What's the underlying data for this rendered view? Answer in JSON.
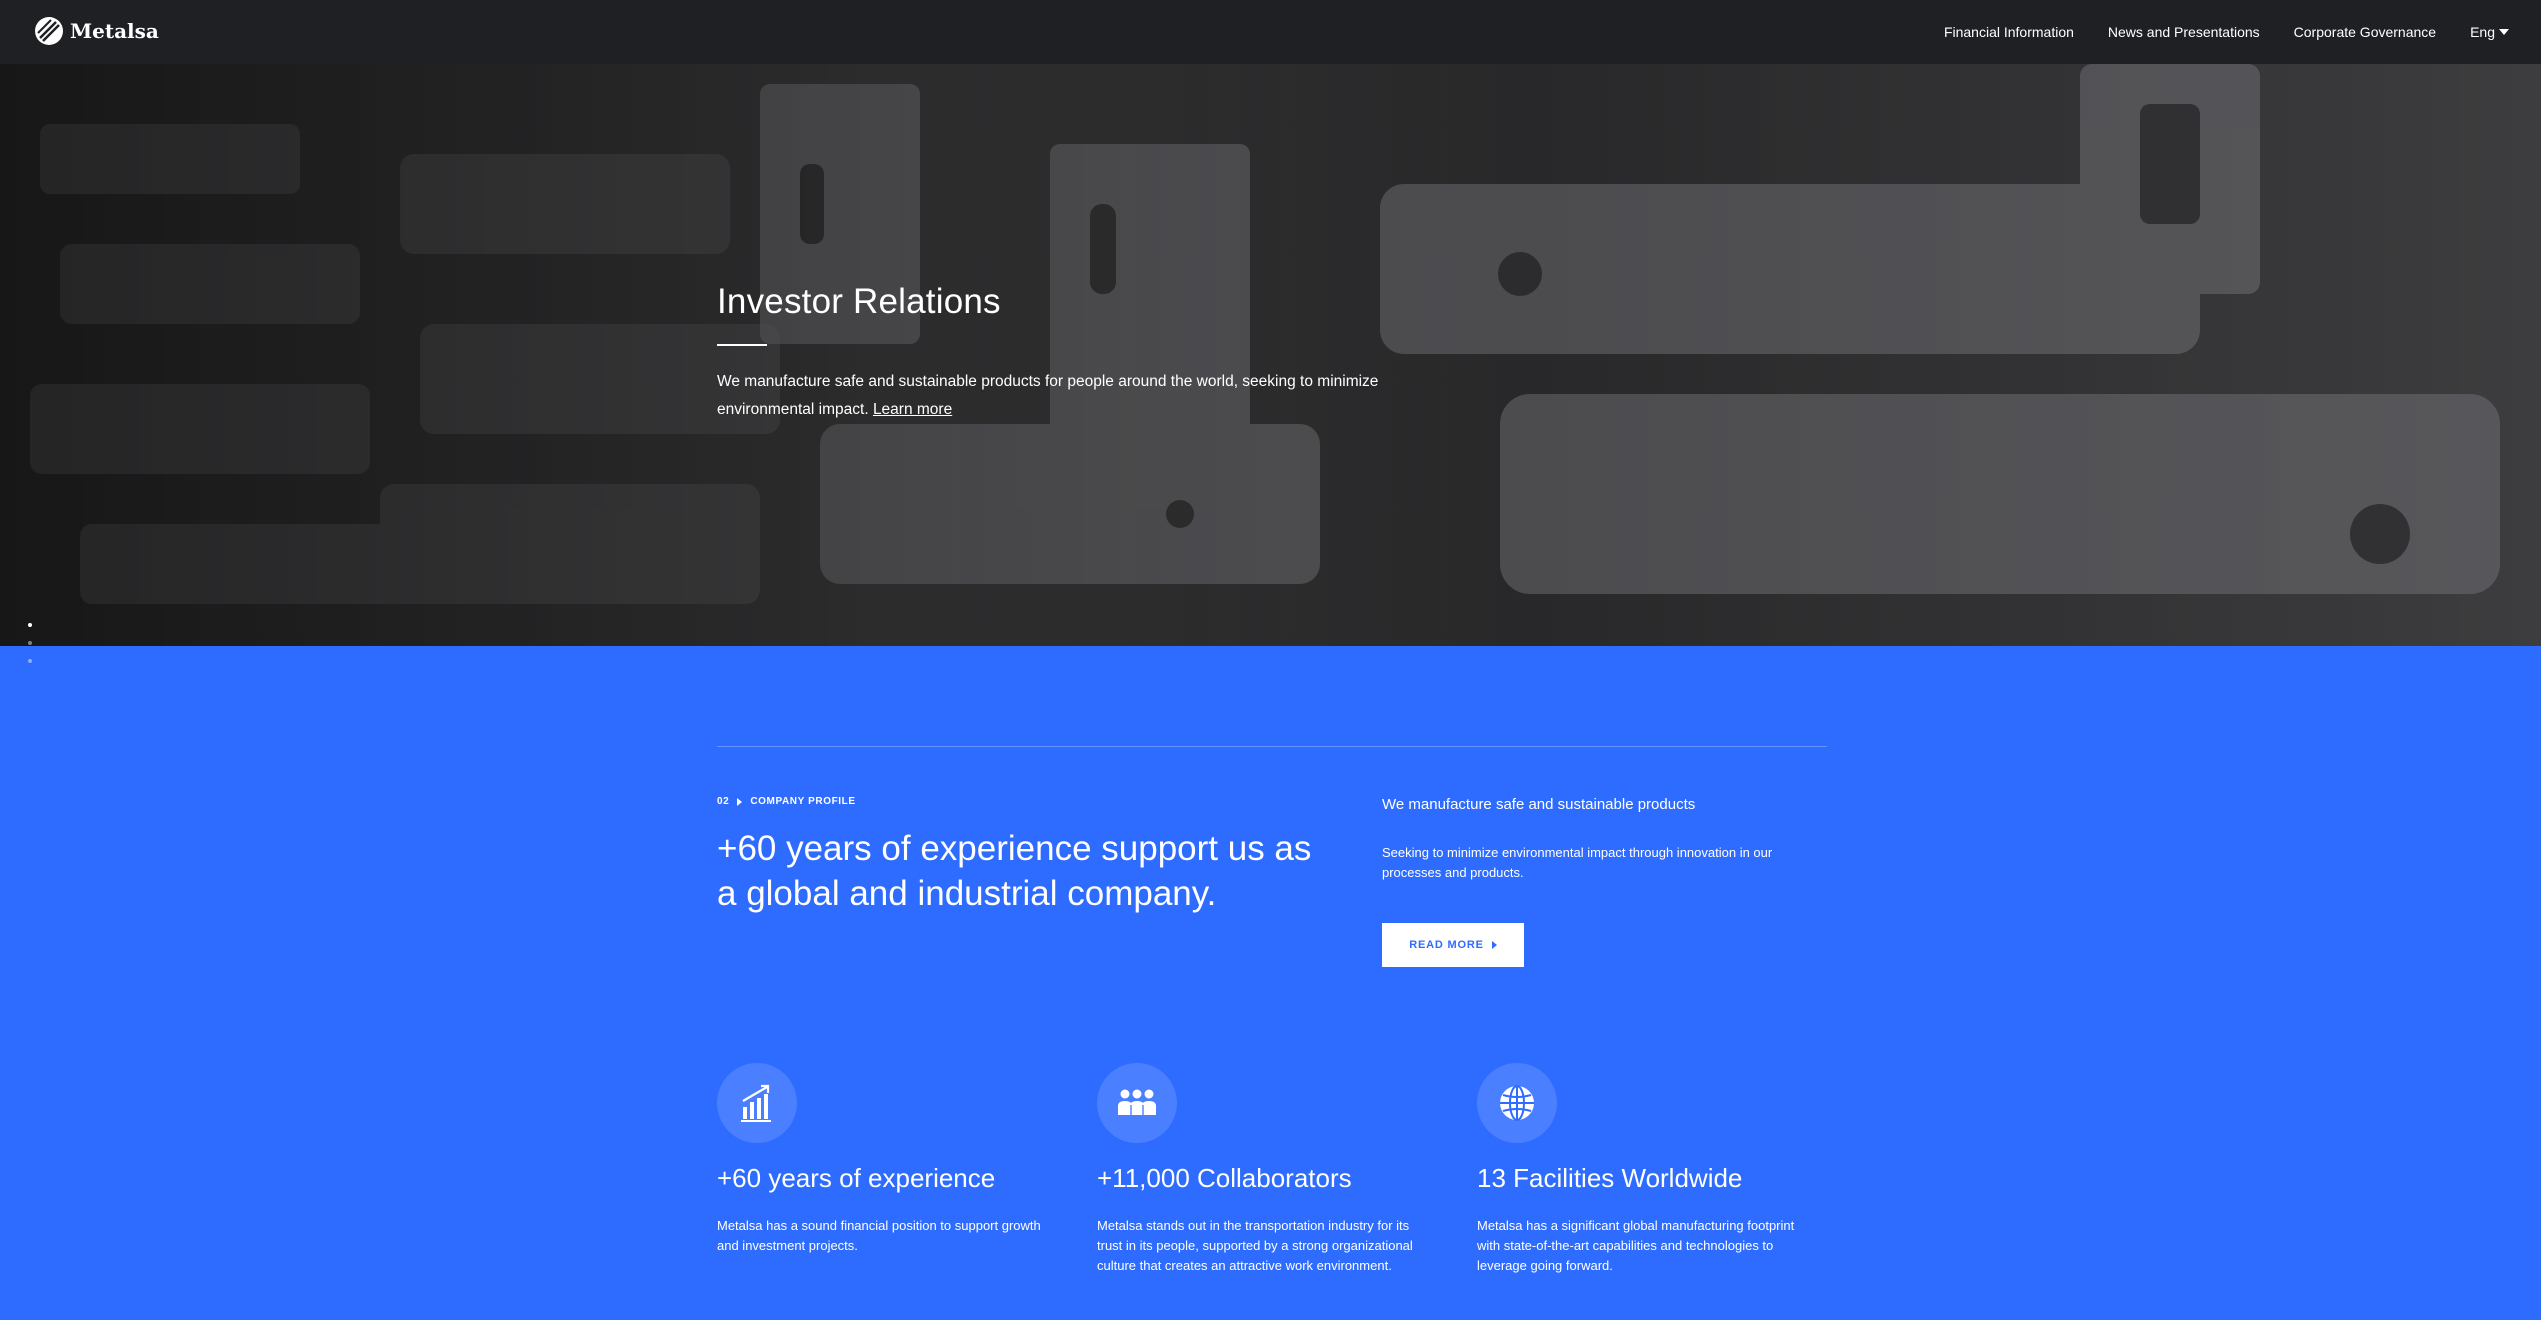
{
  "header": {
    "logo_text": "Metalsa",
    "nav": [
      {
        "label": "Financial Information"
      },
      {
        "label": "News and Presentations"
      },
      {
        "label": "Corporate Governance"
      }
    ],
    "language": "Eng"
  },
  "hero": {
    "title": "Investor Relations",
    "description": "We manufacture safe and sustainable products for people around the world, seeking to minimize environmental impact.",
    "link_label": "Learn more"
  },
  "profile": {
    "kicker_number": "02",
    "kicker_label": "COMPANY PROFILE",
    "heading": "+60 years of experience support us as a global and industrial company.",
    "right_title": "We manufacture safe and sustainable products",
    "right_desc": "Seeking to minimize environmental impact through innovation in our processes and products.",
    "button_label": "READ MORE"
  },
  "stats": [
    {
      "icon": "growth-chart-icon",
      "title": "+60 years of experience",
      "desc": "Metalsa has a sound financial position to support growth and investment projects."
    },
    {
      "icon": "people-group-icon",
      "title": "+11,000 Collaborators",
      "desc": "Metalsa stands out in the transportation industry for its trust in its people, supported by a strong organizational culture that creates an attractive work environment."
    },
    {
      "icon": "globe-icon",
      "title": "13 Facilities Worldwide",
      "desc": "Metalsa has a significant global manufacturing footprint with state-of-the-art capabilities and technologies to leverage going forward."
    }
  ],
  "colors": {
    "brand_blue": "#2d6cff",
    "topbar": "#1e2024"
  }
}
